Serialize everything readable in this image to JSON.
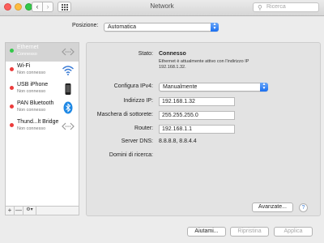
{
  "window": {
    "title": "Network"
  },
  "toolbar": {
    "back_glyph": "‹",
    "forward_glyph": "›",
    "search_placeholder": "Ricerca"
  },
  "location": {
    "label": "Posizione:",
    "value": "Automatica"
  },
  "services": [
    {
      "name": "Ethernet",
      "status": "Connesso",
      "dot_color": "#34c84a",
      "icon": "ethernet-icon",
      "selected": true
    },
    {
      "name": "Wi-Fi",
      "status": "Non connesso",
      "dot_color": "#ec3c3c",
      "icon": "wifi-icon",
      "selected": false
    },
    {
      "name": "USB iPhone",
      "status": "Non connesso",
      "dot_color": "#ec3c3c",
      "icon": "iphone-icon",
      "selected": false
    },
    {
      "name": "PAN Bluetooth",
      "status": "Non connesso",
      "dot_color": "#ec3c3c",
      "icon": "bluetooth-icon",
      "selected": false
    },
    {
      "name": "Thund...lt Bridge",
      "status": "Non connesso",
      "dot_color": "#ec3c3c",
      "icon": "thunderbolt-bridge-icon",
      "selected": false
    }
  ],
  "sidebar_footer": {
    "add": "+",
    "remove": "—",
    "action": "⚙▾"
  },
  "detail": {
    "status_label": "Stato:",
    "status_value": "Connesso",
    "status_desc": "Ethernet è attualmente attivo con l'indirizzo IP 192.168.1.32.",
    "ipv4_label": "Configura IPv4:",
    "ipv4_value": "Manualmente",
    "ip_label": "Indirizzo IP:",
    "ip_value": "192.168.1.32",
    "mask_label": "Maschera di sottorete:",
    "mask_value": "255.255.255.0",
    "router_label": "Router:",
    "router_value": "192.168.1.1",
    "dns_label": "Server DNS:",
    "dns_value": "8.8.8.8, 8.8.4.4",
    "domains_label": "Domini di ricerca:",
    "advanced": "Avanzate...",
    "help": "?"
  },
  "footer": {
    "assist": "Aiutami...",
    "revert": "Ripristina",
    "apply": "Applica"
  },
  "colors": {
    "accent": "#1a6ff0",
    "connected": "#34c84a",
    "disconnected": "#ec3c3c"
  }
}
